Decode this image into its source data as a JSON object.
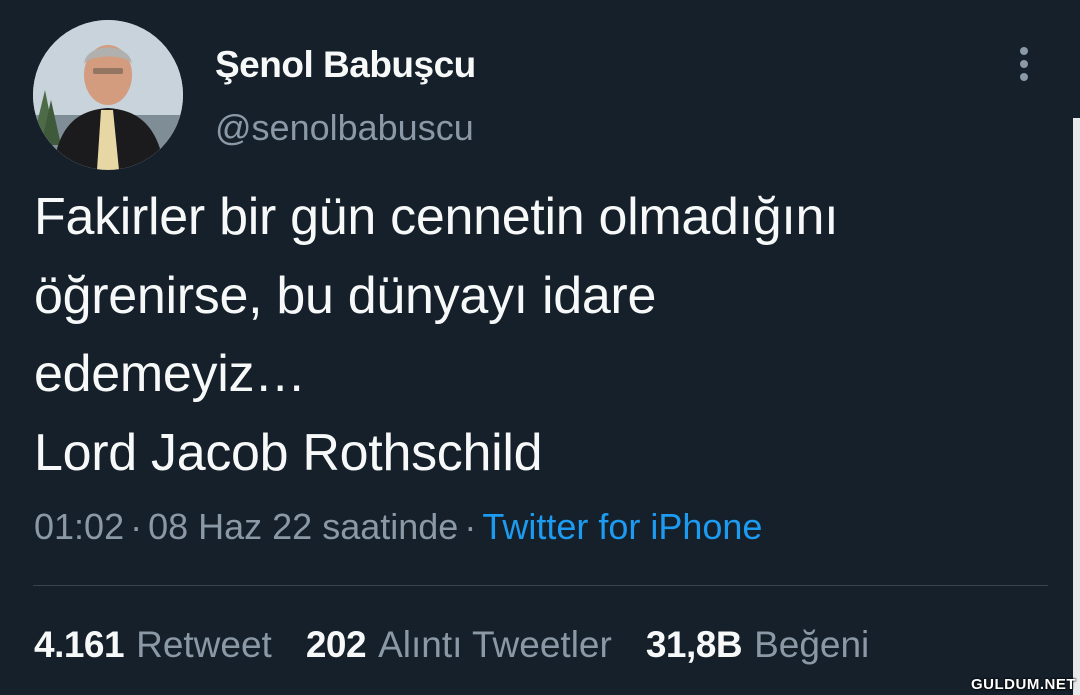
{
  "author": {
    "name": "Şenol Babuşcu",
    "handle": "@senolbabuscu"
  },
  "tweet": {
    "lines": [
      "Fakirler bir gün cennetin olmadığını",
      "öğrenirse, bu dünyayı idare",
      "edemeyiz…",
      "Lord Jacob Rothschild"
    ]
  },
  "meta": {
    "time": "01:02",
    "separator": "·",
    "date": "08 Haz 22 saatinde",
    "source": "Twitter for iPhone"
  },
  "stats": {
    "retweets": {
      "count": "4.161",
      "label": "Retweet"
    },
    "quotes": {
      "count": "202",
      "label": "Alıntı Tweetler"
    },
    "likes": {
      "count": "31,8B",
      "label": "Beğeni"
    }
  },
  "icons": {
    "more": "more-vertical-icon"
  },
  "colors": {
    "background": "#15202b",
    "text": "#f7f9f9",
    "secondary": "#8b98a5",
    "link": "#1d9bf0",
    "divider": "#38444d"
  },
  "watermark": "GULDUM.NET"
}
